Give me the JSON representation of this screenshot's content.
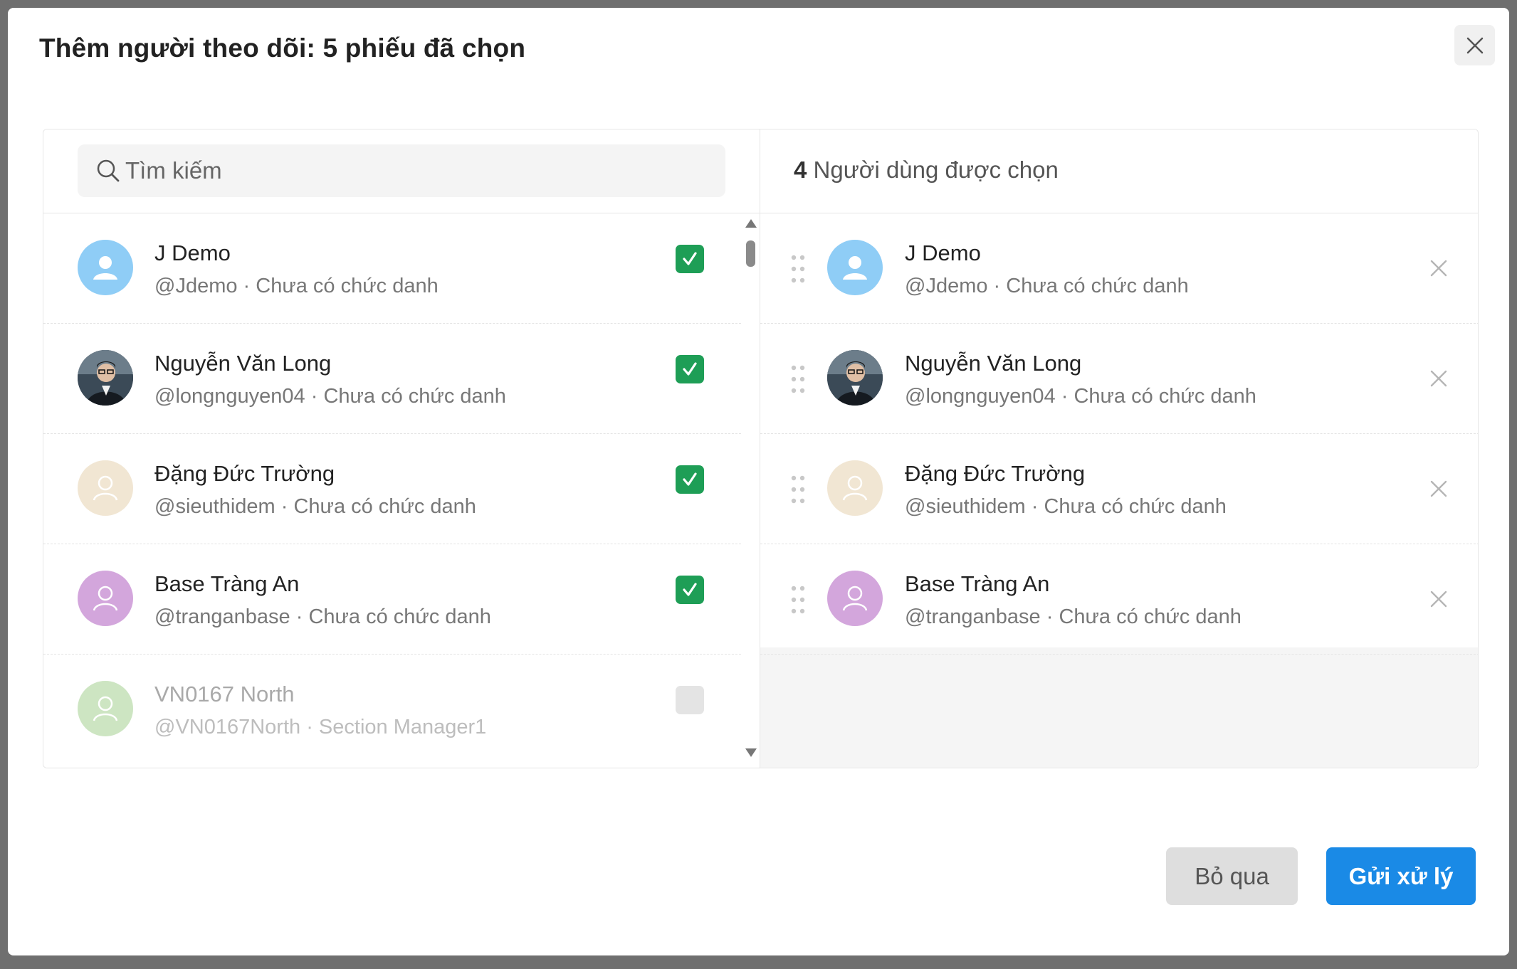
{
  "modal": {
    "title": "Thêm người theo dõi: 5 phiếu đã chọn",
    "close_icon": "close-icon"
  },
  "search": {
    "placeholder": "Tìm kiếm",
    "value": ""
  },
  "candidates": [
    {
      "name": "J Demo",
      "sub": "@Jdemo · Chưa có chức danh",
      "checked": true,
      "avatar": "user-icon",
      "avatar_color": "#8fcdf6"
    },
    {
      "name": "Nguyễn Văn Long",
      "sub": "@longnguyen04 · Chưa có chức danh",
      "checked": true,
      "avatar": "photo",
      "avatar_color": "#33404c"
    },
    {
      "name": "Đặng Đức Trường",
      "sub": "@sieuthidem · Chưa có chức danh",
      "checked": true,
      "avatar": "user-icon",
      "avatar_color": "#f1e6d3"
    },
    {
      "name": "Base Tràng An",
      "sub": "@tranganbase · Chưa có chức danh",
      "checked": true,
      "avatar": "user-icon",
      "avatar_color": "#d3a6dc"
    },
    {
      "name": "VN0167 North",
      "sub": "@VN0167North · Section Manager1",
      "checked": false,
      "avatar": "user-icon",
      "avatar_color": "#cde5c2"
    }
  ],
  "selected": {
    "count": "4",
    "label": "Người dùng được chọn",
    "items": [
      {
        "name": "J Demo",
        "sub": "@Jdemo · Chưa có chức danh"
      },
      {
        "name": "Nguyễn Văn Long",
        "sub": "@longnguyen04 · Chưa có chức danh"
      },
      {
        "name": "Đặng Đức Trường",
        "sub": "@sieuthidem · Chưa có chức danh"
      },
      {
        "name": "Base Tràng An",
        "sub": "@tranganbase · Chưa có chức danh"
      }
    ]
  },
  "footer": {
    "cancel_label": "Bỏ qua",
    "submit_label": "Gửi xử lý"
  },
  "colors": {
    "check_green": "#1e9e56",
    "primary_blue": "#1a8ae6"
  }
}
